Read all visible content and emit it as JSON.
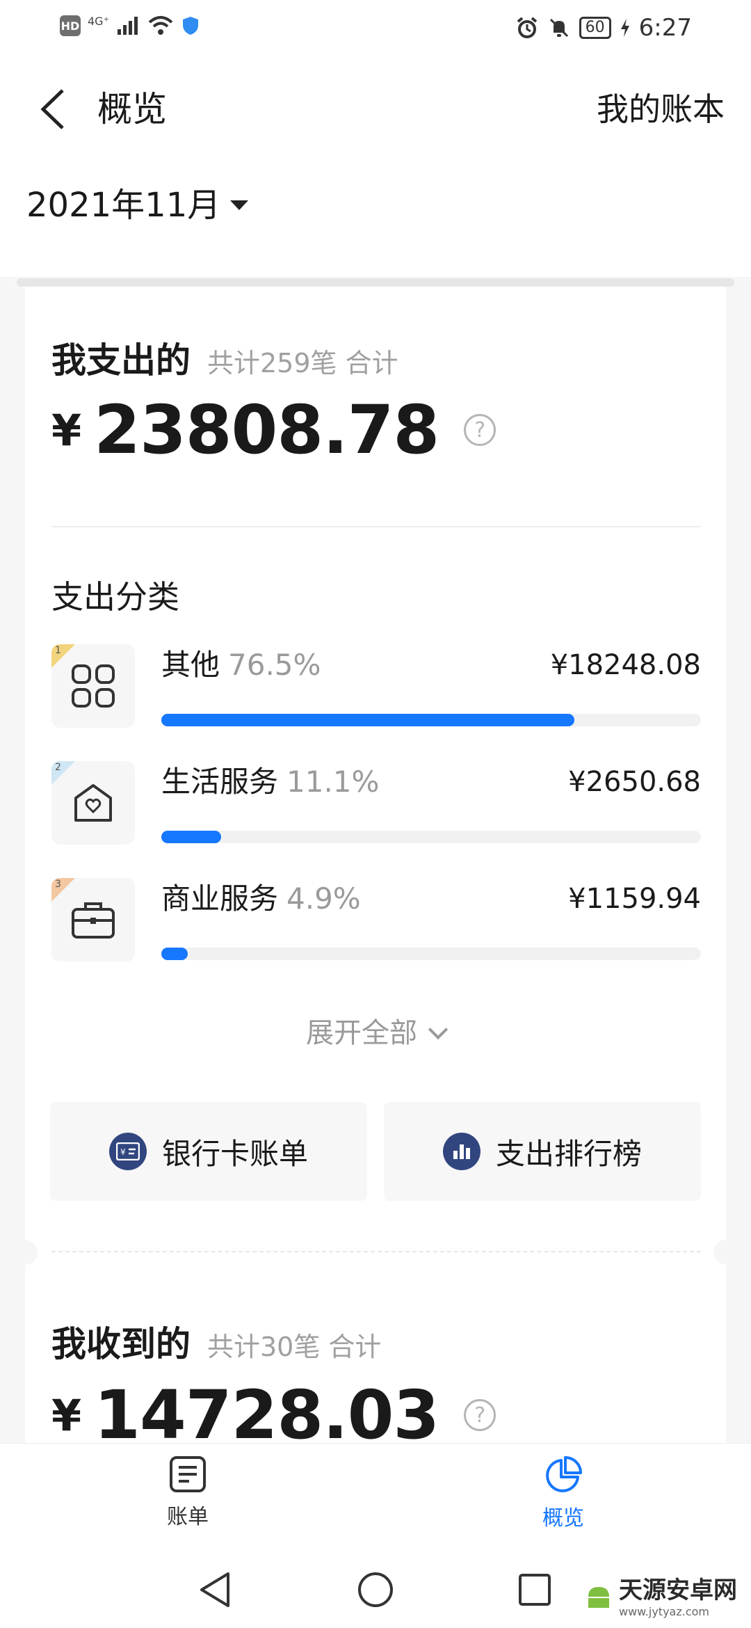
{
  "status_bar": {
    "left_badge": "HD",
    "network": "4G⁺",
    "battery": "60",
    "time": "6:27"
  },
  "header": {
    "title": "概览",
    "right_link": "我的账本"
  },
  "month_selector": {
    "label": "2021年11月"
  },
  "expense": {
    "title": "我支出的",
    "subtitle": "共计259笔 合计",
    "currency": "¥",
    "amount": "23808.78",
    "help": "?"
  },
  "categories": {
    "title": "支出分类",
    "items": [
      {
        "rank": "1",
        "name": "其他",
        "pct": "76.5%",
        "amount": "¥18248.08",
        "fill": 0.765,
        "icon": "grid-icon"
      },
      {
        "rank": "2",
        "name": "生活服务",
        "pct": "11.1%",
        "amount": "¥2650.68",
        "fill": 0.111,
        "icon": "home-heart-icon"
      },
      {
        "rank": "3",
        "name": "商业服务",
        "pct": "4.9%",
        "amount": "¥1159.94",
        "fill": 0.049,
        "icon": "briefcase-icon"
      }
    ]
  },
  "expand_all": "展开全部",
  "actions": {
    "bank_bill": "银行卡账单",
    "ranking": "支出排行榜"
  },
  "income": {
    "title": "我收到的",
    "subtitle": "共计30笔 合计",
    "currency": "¥",
    "amount": "14728.03",
    "help": "?"
  },
  "bottom_nav": {
    "tabs": [
      {
        "label": "账单",
        "icon": "bill-list-icon",
        "active": false
      },
      {
        "label": "概览",
        "icon": "pie-chart-icon",
        "active": true
      }
    ]
  },
  "watermark": {
    "name": "天源安卓网",
    "url": "www.jytyaz.com"
  },
  "colors": {
    "accent": "#1677ff",
    "action_icon_bg": "#31467f"
  }
}
